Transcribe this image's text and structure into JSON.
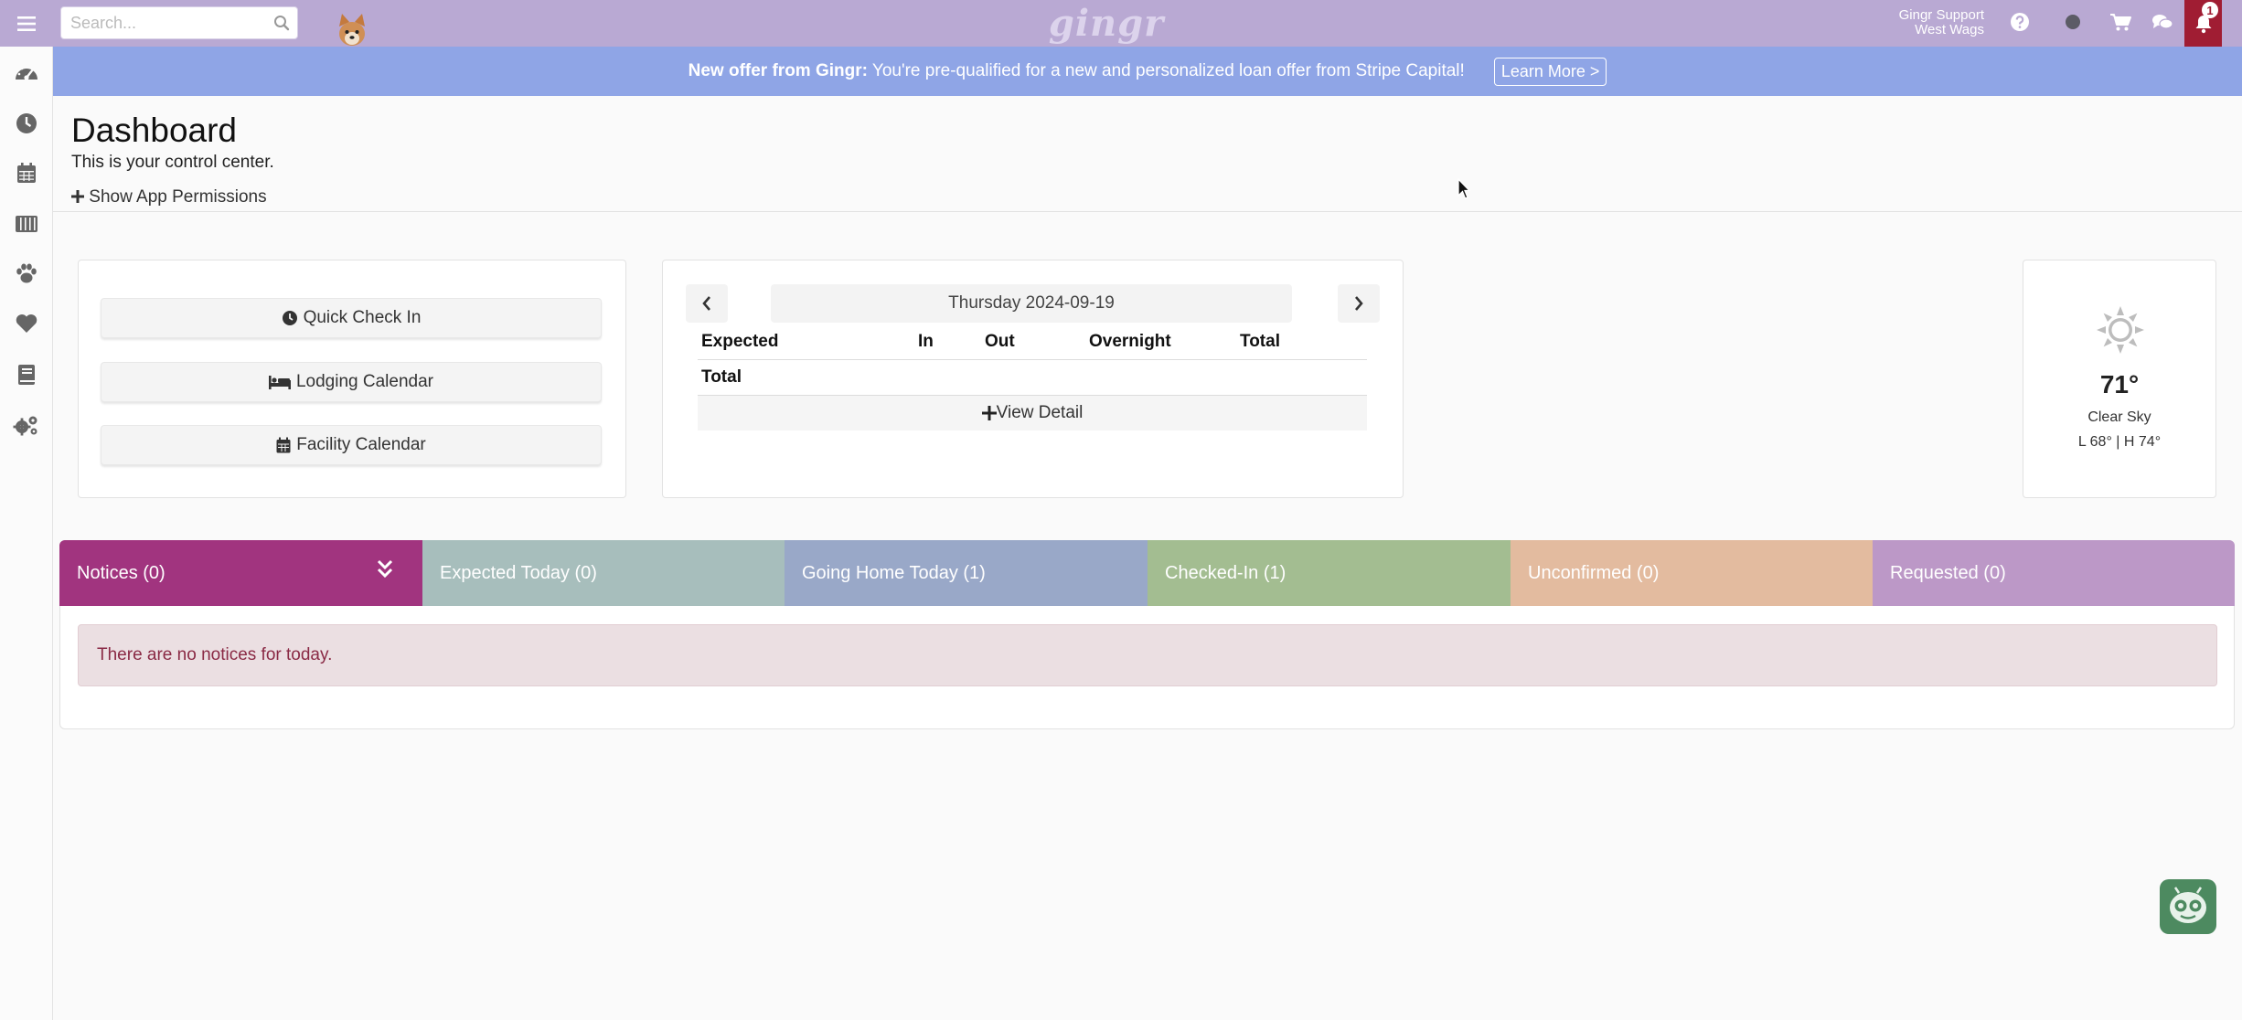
{
  "topbar": {
    "search_placeholder": "Search...",
    "logo": "gingr",
    "user_name": "Gingr Support",
    "location": "West Wags",
    "notification_count": "1"
  },
  "banner": {
    "bold": "New offer from Gingr:",
    "text": " You're pre-qualified for a new and personalized loan offer from Stripe Capital!",
    "button": "Learn More >"
  },
  "header": {
    "title": "Dashboard",
    "subtitle": "This is your control center.",
    "permissions_link": "Show App Permissions"
  },
  "quick_actions": {
    "check_in": "Quick Check In",
    "lodging": "Lodging Calendar",
    "facility": "Facility Calendar"
  },
  "calendar": {
    "date": "Thursday 2024-09-19",
    "headers": [
      "Expected",
      "In",
      "Out",
      "Overnight",
      "Total"
    ],
    "total_label": "Total",
    "view_detail": "View Detail"
  },
  "weather": {
    "temp": "71°",
    "desc": "Clear Sky",
    "range": "L 68° | H 74°"
  },
  "tabs": [
    {
      "label": "Notices (0)",
      "color": "#a1347f"
    },
    {
      "label": "Expected Today (0)",
      "color": "#a7bebc"
    },
    {
      "label": "Going Home Today (1)",
      "color": "#99a8c8"
    },
    {
      "label": "Checked-In (1)",
      "color": "#a3bd91"
    },
    {
      "label": "Unconfirmed (0)",
      "color": "#e3bb9f"
    },
    {
      "label": "Requested (0)",
      "color": "#bc98c7"
    }
  ],
  "notice_message": "There are no notices for today."
}
